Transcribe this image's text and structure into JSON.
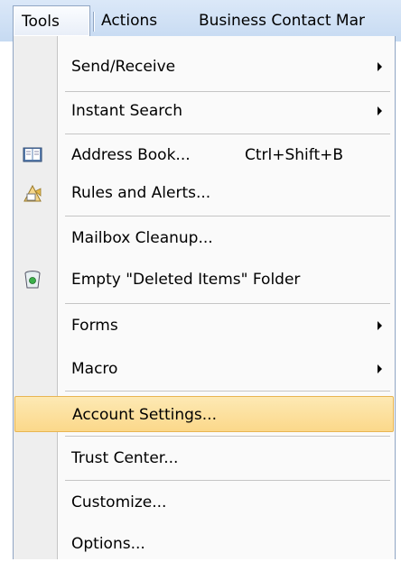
{
  "menubar": {
    "tools": "Tools",
    "actions": "Actions",
    "business_contact": "Business Contact Mar"
  },
  "menu": {
    "send_receive": "Send/Receive",
    "instant_search": "Instant Search",
    "address_book": "Address Book...",
    "address_book_shortcut": "Ctrl+Shift+B",
    "rules_alerts": "Rules and Alerts...",
    "mailbox_cleanup": "Mailbox Cleanup...",
    "empty_deleted": "Empty \"Deleted Items\" Folder",
    "forms": "Forms",
    "macro": "Macro",
    "account_settings": "Account Settings...",
    "trust_center": "Trust Center...",
    "customize": "Customize...",
    "options": "Options..."
  },
  "colors": {
    "menubar": "#c6daf2",
    "highlight": "#fbd88a",
    "highlight_border": "#e8b552",
    "gutter": "#eeeeee"
  },
  "icons": {
    "address_book": "address-book-icon",
    "rules_alerts": "rules-alerts-icon",
    "empty_deleted": "recycle-bin-icon"
  }
}
